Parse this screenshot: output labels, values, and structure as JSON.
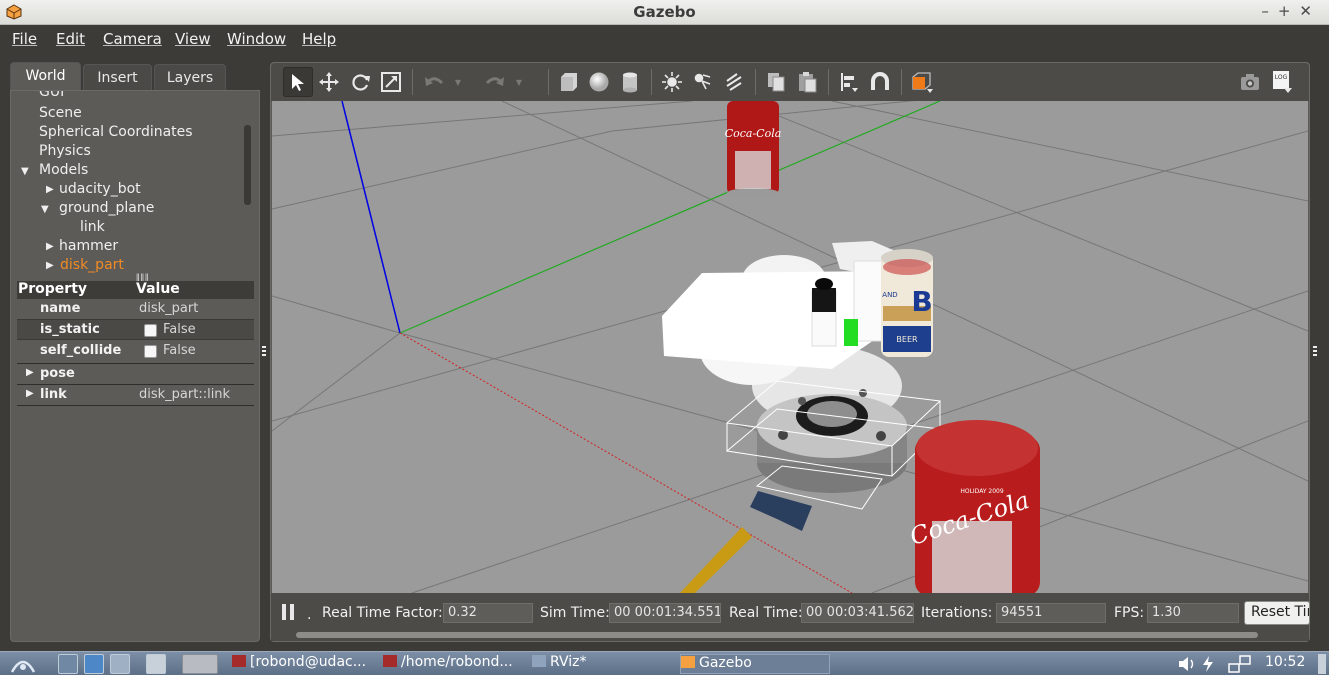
{
  "window": {
    "title": "Gazebo",
    "controls": [
      "–",
      "+",
      "✕"
    ]
  },
  "menu": [
    {
      "label": "File"
    },
    {
      "label": "Edit"
    },
    {
      "label": "Camera"
    },
    {
      "label": "View"
    },
    {
      "label": "Window"
    },
    {
      "label": "Help"
    }
  ],
  "left_panel": {
    "tabs": [
      {
        "label": "World",
        "active": true
      },
      {
        "label": "Insert"
      },
      {
        "label": "Layers"
      }
    ],
    "tree": [
      {
        "label": "GUI"
      },
      {
        "label": "Scene"
      },
      {
        "label": "Spherical Coordinates"
      },
      {
        "label": "Physics"
      },
      {
        "label": "Models"
      },
      {
        "label": "udacity_bot"
      },
      {
        "label": "ground_plane"
      },
      {
        "label": "link"
      },
      {
        "label": "hammer"
      },
      {
        "label": "disk_part",
        "selected": true
      }
    ],
    "properties": {
      "header": {
        "property": "Property",
        "value": "Value"
      },
      "rows": [
        {
          "key": "name",
          "value": "disk_part"
        },
        {
          "key": "is_static",
          "value": "False"
        },
        {
          "key": "self_collide",
          "value": "False"
        },
        {
          "key": "pose",
          "value": ""
        },
        {
          "key": "link",
          "value": "disk_part::link"
        }
      ]
    }
  },
  "toolbar": {
    "icons": [
      "select-icon",
      "translate-icon",
      "rotate-icon",
      "scale-icon",
      "undo-icon",
      "redo-icon",
      "box-icon",
      "sphere-icon",
      "cylinder-icon",
      "point-light-icon",
      "spot-light-icon",
      "directional-light-icon",
      "copy-icon",
      "paste-icon",
      "align-icon",
      "snap-icon",
      "view-angle-icon",
      "screenshot-icon",
      "log-icon"
    ],
    "log_label": "LOG"
  },
  "scene": {
    "can_label_1": "Coca-Cola",
    "can_label_2": "Coca-Cola",
    "can_label_2_small": "HOLIDAY 2009",
    "beer_label": "B",
    "beer_small": "AND",
    "beer_band": "BEER"
  },
  "status": {
    "real_time_factor_label": "Real Time Factor:",
    "real_time_factor": "0.32",
    "sim_time_label": "Sim Time:",
    "sim_time": "00 00:01:34.551",
    "real_time_label": "Real Time:",
    "real_time": "00 00:03:41.562",
    "iterations_label": "Iterations:",
    "iterations": "94551",
    "fps_label": "FPS:",
    "fps": "1.30",
    "reset_label": "Reset Time"
  },
  "taskbar": {
    "tasks": [
      {
        "label": "[robond@udac..."
      },
      {
        "label": "/home/robond..."
      },
      {
        "label": "RViz*"
      },
      {
        "label": "Gazebo"
      }
    ],
    "clock": "10:52"
  },
  "colors": {
    "accent": "#f08a24",
    "panel": "#5c5b57",
    "ground": "#9b9b9b"
  }
}
